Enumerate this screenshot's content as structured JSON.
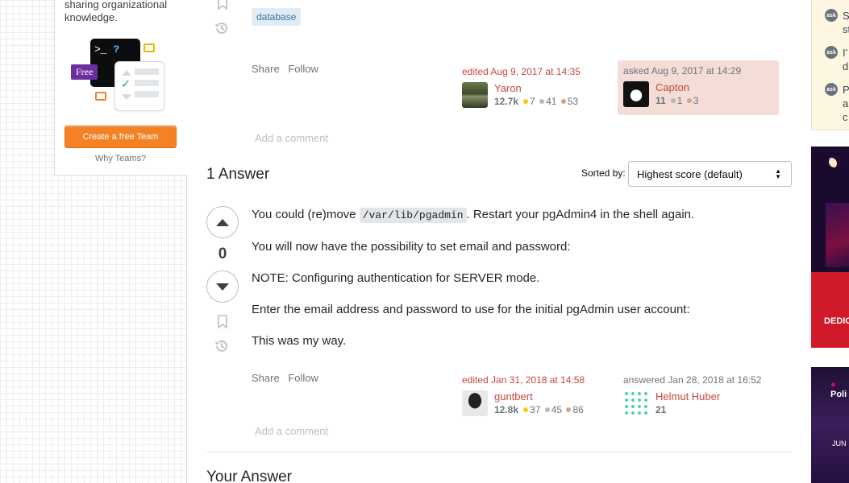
{
  "left_sidebar": {
    "teams_text": "sharing organizational knowledge.",
    "terminal_prompt": ">_",
    "terminal_q": "?",
    "free_tag": "Free",
    "create_team_label": "Create a free Team",
    "why_teams_label": "Why Teams?"
  },
  "question": {
    "tag": "database",
    "menu": {
      "share": "Share",
      "follow": "Follow"
    },
    "edited": {
      "when": "edited Aug 9, 2017 at 14:35",
      "user": "Yaron",
      "rep": "12.7k",
      "gold": "7",
      "silver": "41",
      "bronze": "53"
    },
    "asked": {
      "when": "asked Aug 9, 2017 at 14:29",
      "user": "Capton",
      "rep": "11",
      "silver": "1",
      "bronze": "3"
    },
    "add_comment": "Add a comment"
  },
  "answers": {
    "header": "1 Answer",
    "sorted_label": "Sorted by:",
    "sort_value": "Highest score (default)"
  },
  "answer": {
    "score": "0",
    "p1_before": "You could (re)move ",
    "p1_code": "/var/lib/pgadmin",
    "p1_after": ". Restart your pgAdmin4 in the shell again.",
    "p2": "You will now have the possibility to set email and password:",
    "p3": "NOTE: Configuring authentication for SERVER mode.",
    "p4": "Enter the email address and password to use for the initial pgAdmin user account:",
    "p5": "This was my way.",
    "menu": {
      "share": "Share",
      "follow": "Follow"
    },
    "edited": {
      "when": "edited Jan 31, 2018 at 14:58",
      "user": "guntbert",
      "rep": "12.8k",
      "gold": "37",
      "silver": "45",
      "bronze": "86"
    },
    "answered": {
      "when": "answered Jan 28, 2018 at 16:52",
      "user": "Helmut Huber",
      "rep": "21"
    },
    "add_comment": "Add a comment"
  },
  "your_answer_title": "Your Answer",
  "right_rail": {
    "hot_items": [
      {
        "icon": "ask",
        "lines": [
          "S",
          "st"
        ]
      },
      {
        "icon": "ask",
        "lines": [
          "I'",
          "d"
        ]
      },
      {
        "icon": "ask",
        "lines": [
          "P",
          "a",
          "c"
        ]
      }
    ],
    "ad1_text": "DEDIC",
    "ad2_logo": "Poli",
    "ad2_date": "JUN"
  },
  "colors": {
    "accent_orange": "#f48225",
    "link_red": "#c9463d",
    "tag_bg": "#e1ecf4",
    "tag_fg": "#39739d",
    "owner_bg": "#f4dcd7"
  }
}
